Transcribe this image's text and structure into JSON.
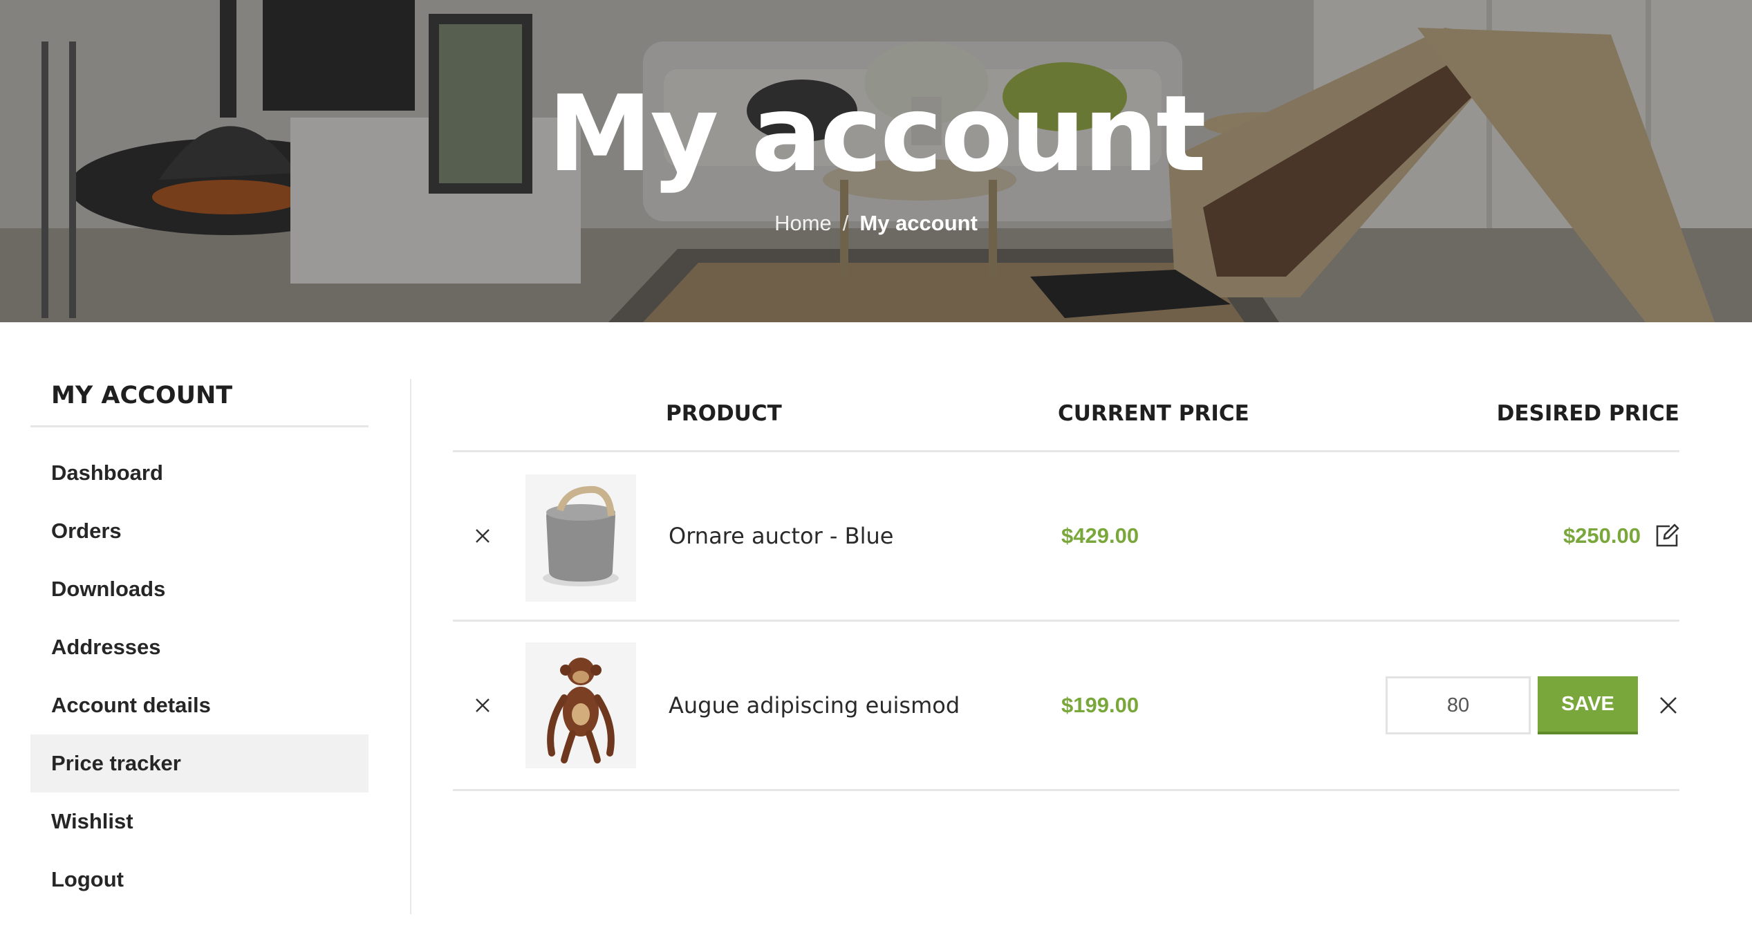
{
  "hero": {
    "title": "My account",
    "breadcrumb": {
      "home": "Home",
      "separator": "/",
      "current": "My account"
    }
  },
  "sidebar": {
    "heading": "MY ACCOUNT",
    "items": [
      {
        "label": "Dashboard",
        "active": false
      },
      {
        "label": "Orders",
        "active": false
      },
      {
        "label": "Downloads",
        "active": false
      },
      {
        "label": "Addresses",
        "active": false
      },
      {
        "label": "Account details",
        "active": false
      },
      {
        "label": "Price tracker",
        "active": true
      },
      {
        "label": "Wishlist",
        "active": false
      },
      {
        "label": "Logout",
        "active": false
      }
    ]
  },
  "table": {
    "columns": {
      "product": "PRODUCT",
      "current_price": "CURRENT PRICE",
      "desired_price": "DESIRED PRICE"
    },
    "rows": [
      {
        "product": "Ornare auctor - Blue",
        "image": "grey-speaker-image",
        "current_price": "$429.00",
        "desired_price": "$250.00",
        "mode": "view"
      },
      {
        "product": "Augue adipiscing euismod",
        "image": "wooden-monkey-image",
        "current_price": "$199.00",
        "desired_price_input": "80",
        "save_label": "SAVE",
        "mode": "edit"
      }
    ]
  },
  "colors": {
    "accent": "#7aa73c",
    "border": "#e6e6e6",
    "active_bg": "#f1f1f1"
  },
  "icons": {
    "remove": "close-icon",
    "edit": "edit-icon",
    "cancel": "close-icon"
  }
}
